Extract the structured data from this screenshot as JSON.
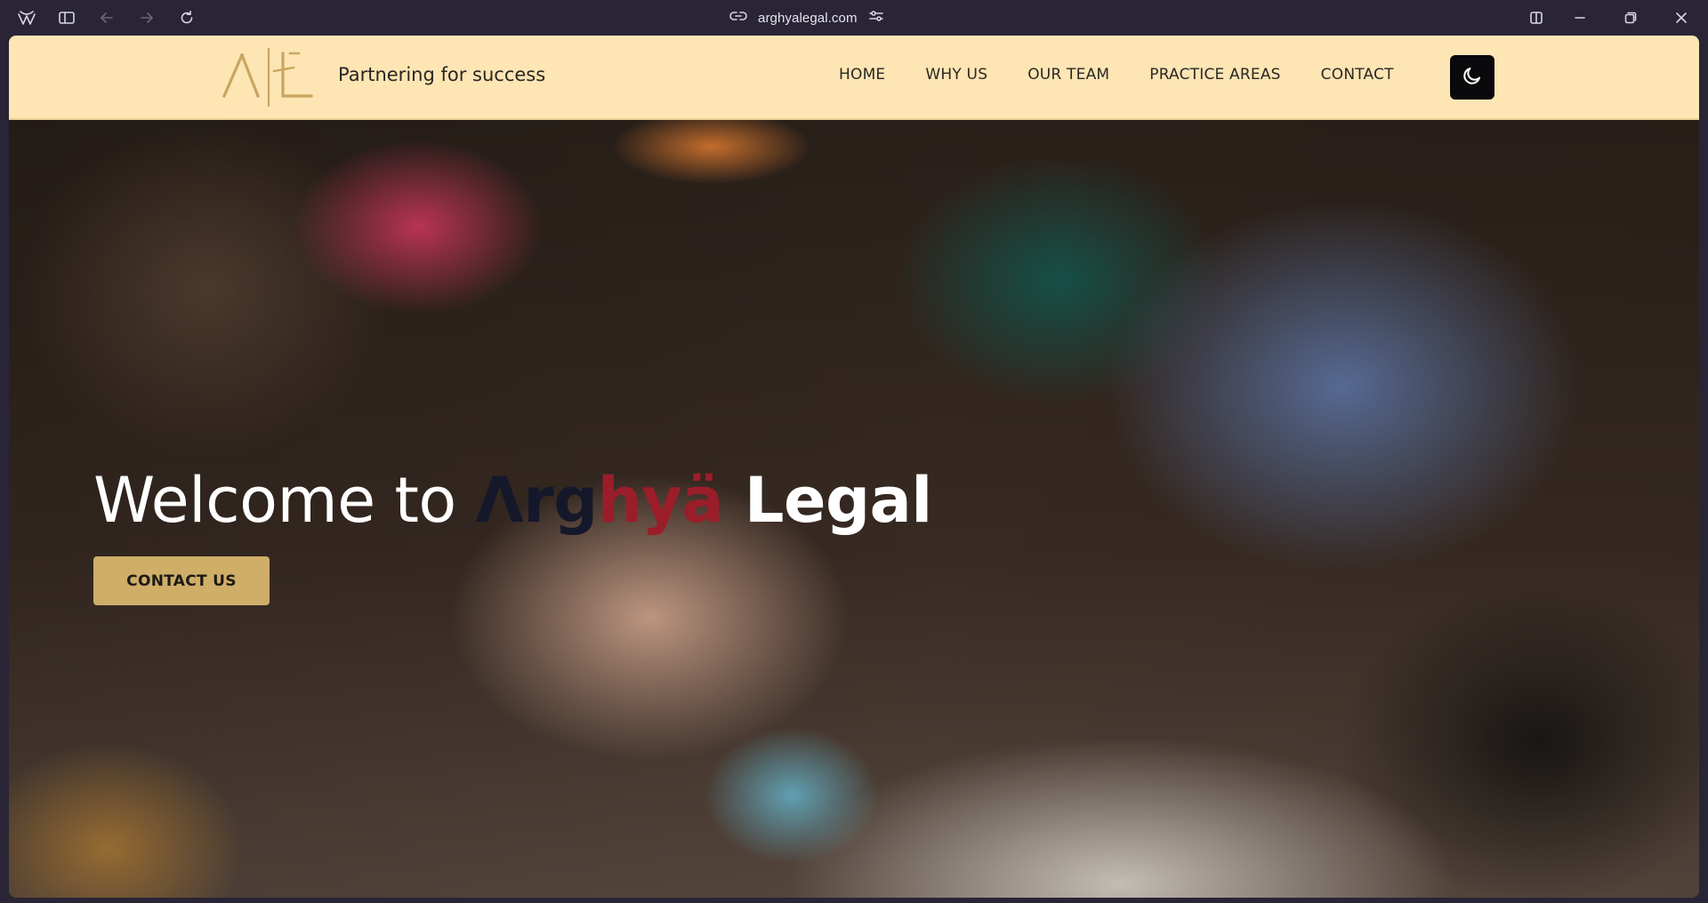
{
  "browser": {
    "url": "arghyalegal.com",
    "icons": [
      "app-logo-icon",
      "sidebar-toggle-icon",
      "back-icon",
      "forward-icon",
      "reload-icon",
      "link-icon",
      "site-settings-icon",
      "split-view-icon",
      "minimize-icon",
      "restore-icon",
      "close-icon"
    ]
  },
  "site": {
    "tagline": "Partnering for success",
    "nav": [
      "HOME",
      "WHY US",
      "OUR TEAM",
      "PRACTICE AREAS",
      "CONTACT"
    ],
    "theme_toggle_icon": "moon-icon",
    "colors": {
      "header_bg": "#fde5b4",
      "gold": "#cfae68",
      "brand_dark": "#14182a",
      "brand_red": "#9b1d2a"
    }
  },
  "hero": {
    "title_prefix": "Welcome to ",
    "title_brand_1": "Λrg",
    "title_brand_2": "hyä",
    "title_brand_3": " Legal",
    "cta_label": "CONTACT US"
  }
}
